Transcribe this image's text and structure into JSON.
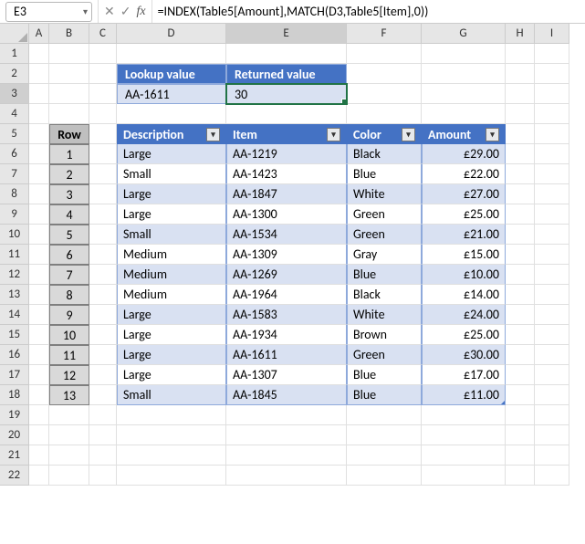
{
  "name_box": "E3",
  "formula": "=INDEX(Table5[Amount],MATCH(D3,Table5[Item],0))",
  "columns": [
    "A",
    "B",
    "C",
    "D",
    "E",
    "F",
    "G",
    "H",
    "I"
  ],
  "rows": [
    "1",
    "2",
    "3",
    "4",
    "5",
    "6",
    "7",
    "8",
    "9",
    "10",
    "11",
    "12",
    "13",
    "14",
    "15",
    "16",
    "17",
    "18",
    "19",
    "20",
    "21",
    "22"
  ],
  "lookup": {
    "h1": "Lookup value",
    "h2": "Returned value",
    "v1": "AA-1611",
    "v2": "30"
  },
  "rowlabel_header": "Row",
  "table_headers": {
    "desc": "Description",
    "item": "Item",
    "color": "Color",
    "amount": "Amount"
  },
  "chart_data": {
    "type": "table",
    "columns": [
      "Row",
      "Description",
      "Item",
      "Color",
      "Amount"
    ],
    "rows": [
      {
        "row": "1",
        "desc": "Large",
        "item": "AA-1219",
        "color": "Black",
        "amount": "£29.00"
      },
      {
        "row": "2",
        "desc": "Small",
        "item": "AA-1423",
        "color": "Blue",
        "amount": "£22.00"
      },
      {
        "row": "3",
        "desc": "Large",
        "item": "AA-1847",
        "color": "White",
        "amount": "£27.00"
      },
      {
        "row": "4",
        "desc": "Large",
        "item": "AA-1300",
        "color": "Green",
        "amount": "£25.00"
      },
      {
        "row": "5",
        "desc": "Small",
        "item": "AA-1534",
        "color": "Green",
        "amount": "£21.00"
      },
      {
        "row": "6",
        "desc": "Medium",
        "item": "AA-1309",
        "color": "Gray",
        "amount": "£15.00"
      },
      {
        "row": "7",
        "desc": "Medium",
        "item": "AA-1269",
        "color": "Blue",
        "amount": "£10.00"
      },
      {
        "row": "8",
        "desc": "Medium",
        "item": "AA-1964",
        "color": "Black",
        "amount": "£14.00"
      },
      {
        "row": "9",
        "desc": "Large",
        "item": "AA-1583",
        "color": "White",
        "amount": "£24.00"
      },
      {
        "row": "10",
        "desc": "Large",
        "item": "AA-1934",
        "color": "Brown",
        "amount": "£25.00"
      },
      {
        "row": "11",
        "desc": "Large",
        "item": "AA-1611",
        "color": "Green",
        "amount": "£30.00"
      },
      {
        "row": "12",
        "desc": "Large",
        "item": "AA-1307",
        "color": "Blue",
        "amount": "£17.00"
      },
      {
        "row": "13",
        "desc": "Small",
        "item": "AA-1845",
        "color": "Blue",
        "amount": "£11.00"
      }
    ]
  }
}
